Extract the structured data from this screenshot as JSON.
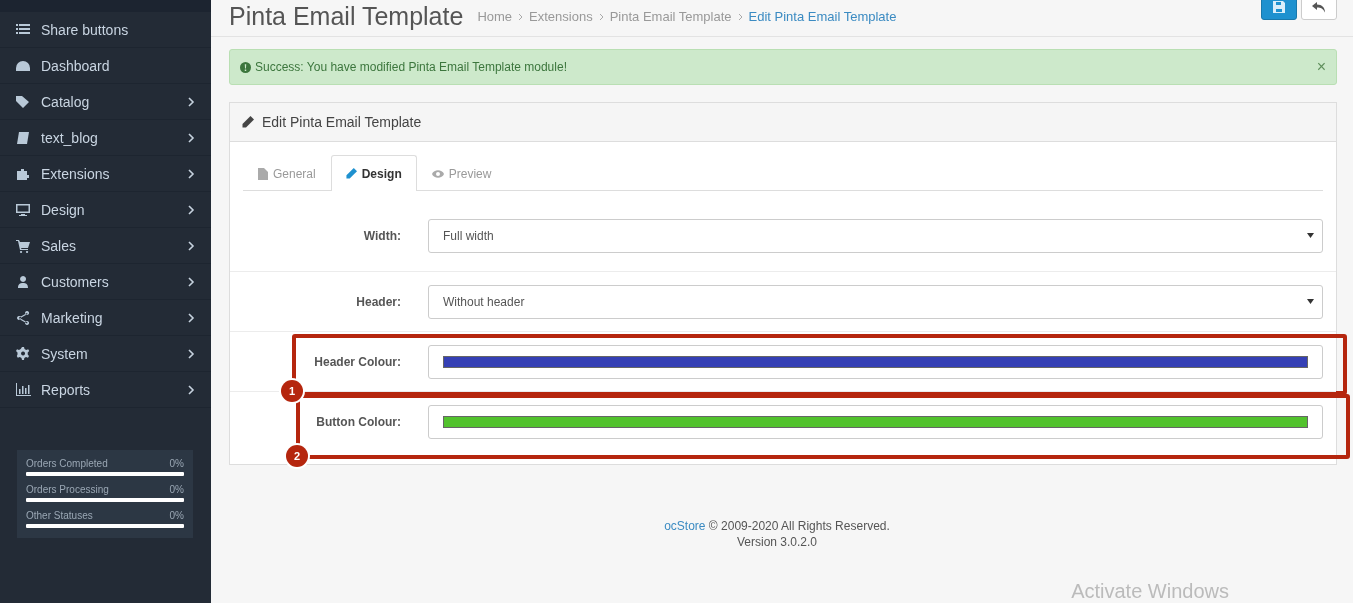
{
  "sidebar": {
    "items": [
      {
        "label": "Share buttons",
        "submenu": false
      },
      {
        "label": "Dashboard",
        "submenu": false
      },
      {
        "label": "Catalog",
        "submenu": true
      },
      {
        "label": "text_blog",
        "submenu": true
      },
      {
        "label": "Extensions",
        "submenu": true
      },
      {
        "label": "Design",
        "submenu": true
      },
      {
        "label": "Sales",
        "submenu": true
      },
      {
        "label": "Customers",
        "submenu": true
      },
      {
        "label": "Marketing",
        "submenu": true
      },
      {
        "label": "System",
        "submenu": true
      },
      {
        "label": "Reports",
        "submenu": true
      }
    ],
    "stats": [
      {
        "label": "Orders Completed",
        "reading": "0%",
        "level": 0
      },
      {
        "label": "Orders Processing",
        "reading": "0%",
        "level": 0
      },
      {
        "label": "Other Statuses",
        "reading": "0%",
        "level": 0
      }
    ]
  },
  "page_header": {
    "title": "Pinta Email Template",
    "breadcrumbs": [
      {
        "label": "Home",
        "current": false
      },
      {
        "label": "Extensions",
        "current": false
      },
      {
        "label": "Pinta Email Template",
        "current": false
      },
      {
        "label": "Edit Pinta Email Template",
        "current": true
      }
    ]
  },
  "alert": {
    "message": "Success: You have modified Pinta Email Template module!",
    "close": "×"
  },
  "panel": {
    "title": "Edit Pinta Email Template",
    "tabs": [
      {
        "label": "General",
        "selected": false
      },
      {
        "label": "Design",
        "selected": true
      },
      {
        "label": "Preview",
        "selected": false
      }
    ],
    "fields": [
      {
        "kind": "select",
        "label": "Width:",
        "value": "Full width"
      },
      {
        "kind": "select",
        "label": "Header:",
        "value": "Without header"
      },
      {
        "kind": "color",
        "label": "Header Colour:",
        "color": "#3540b5",
        "annotation": "1"
      },
      {
        "kind": "color",
        "label": "Button Colour:",
        "color": "#52c22d",
        "annotation": "2"
      }
    ]
  },
  "footer": {
    "brand": "ocStore",
    "text": "© 2009-2020 All Rights Reserved.",
    "version": "Version 3.0.2.0"
  },
  "os_overlay": {
    "text": "Activate Windows"
  }
}
